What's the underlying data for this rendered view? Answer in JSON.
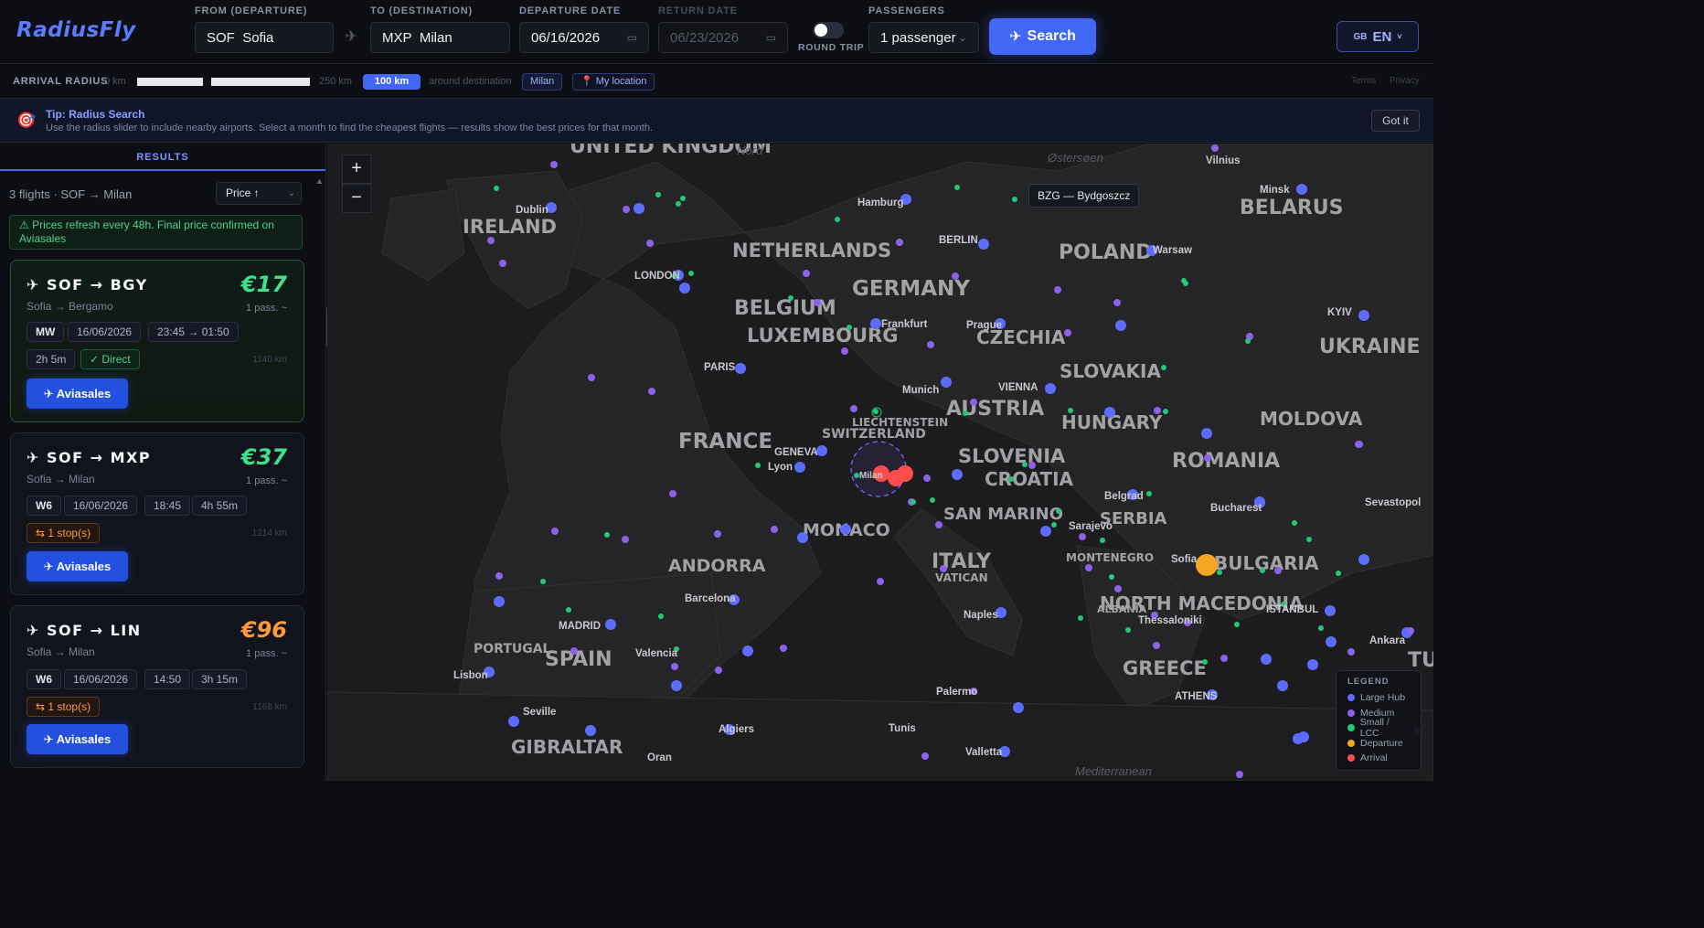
{
  "header": {
    "logo": "RadiusFly",
    "from": {
      "label": "FROM (DEPARTURE)",
      "code": "SOF",
      "city": "Sofia"
    },
    "to": {
      "label": "TO (DESTINATION)",
      "code": "MXP",
      "city": "Milan"
    },
    "departure": {
      "label": "DEPARTURE DATE",
      "value": "06/16/2026"
    },
    "return": {
      "label": "RETURN DATE",
      "value": "06/23/2026"
    },
    "round_trip_label": "ROUND TRIP",
    "round_trip_enabled": false,
    "passengers": {
      "label": "PASSENGERS",
      "value": "1 passenger"
    },
    "search_label": "Search",
    "lang": {
      "flag": "GB",
      "code": "EN"
    }
  },
  "radius": {
    "label": "ARRIVAL RADIUS",
    "min": "0 km",
    "max": "250 km",
    "value": "100 km",
    "around": "around destination",
    "destination_chip": "Milan",
    "location_chip": "My location",
    "terms": "Terms",
    "privacy": "Privacy"
  },
  "tip": {
    "title": "Tip: Radius Search",
    "body": "Use the radius slider to include nearby airports. Select a month to find the cheapest flights — results show the best prices for that month.",
    "dismiss": "Got it"
  },
  "results": {
    "tab": "RESULTS",
    "count": "3 flights · SOF → Milan",
    "sort": "Price ↑",
    "notice": "⚠ Prices refresh every 48h. Final price confirmed on Aviasales",
    "flights": [
      {
        "route": "SOF → BGY",
        "price": "€17",
        "price_color": "#3ee08a",
        "sub": "Sofia → Bergamo",
        "pass": "1 pass. ~",
        "airline": "MW",
        "date": "16/06/2026",
        "time": "23:45 → 01:50",
        "duration": "2h 5m",
        "stops": "✓ Direct",
        "distance": "1140 km",
        "button": "Aviasales"
      },
      {
        "route": "SOF → MXP",
        "price": "€37",
        "price_color": "#3ee08a",
        "sub": "Sofia → Milan",
        "pass": "1 pass. ~",
        "airline": "W6",
        "date": "16/06/2026",
        "time": "18:45",
        "duration": "4h 55m",
        "stops": "⇆ 1 stop(s)",
        "distance": "1214 km",
        "button": "Aviasales"
      },
      {
        "route": "SOF → LIN",
        "price": "€96",
        "price_color": "#ff9a3c",
        "sub": "Sofia → Milan",
        "pass": "1 pass. ~",
        "airline": "W6",
        "date": "16/06/2026",
        "time": "14:50",
        "duration": "3h 15m",
        "stops": "⇆ 1 stop(s)",
        "distance": "1168 km",
        "button": "Aviasales"
      }
    ]
  },
  "map": {
    "zoom_in": "+",
    "zoom_out": "−",
    "tooltip": "BZG — Bydgoszcz",
    "legend": {
      "title": "LEGEND",
      "items": [
        {
          "label": "Large Hub",
          "color": "#5b6cff"
        },
        {
          "label": "Medium",
          "color": "#8a63e8"
        },
        {
          "label": "Small / LCC",
          "color": "#23c77a"
        },
        {
          "label": "Departure",
          "color": "#f5a623"
        },
        {
          "label": "Arrival",
          "color": "#ff4d4d"
        }
      ]
    },
    "countries": [
      "UNITED KINGDOM",
      "IRELAND",
      "NETHERLANDS",
      "BELGIUM",
      "LUXEMBOURG",
      "GERMANY",
      "POLAND",
      "BELARUS",
      "CZECHIA",
      "SLOVAKIA",
      "UKRAINE",
      "AUSTRIA",
      "HUNGARY",
      "MOLDOVA",
      "FRANCE",
      "SWITZERLAND",
      "LIECHTENSTEIN",
      "SLOVENIA",
      "CROATIA",
      "ROMANIA",
      "SAN MARINO",
      "MONACO",
      "SERBIA",
      "ANDORRA",
      "ITALY",
      "VATICAN",
      "BULGARIA",
      "NORTH MACEDONIA",
      "ALBANIA",
      "MONTENEGRO",
      "PORTUGAL",
      "SPAIN",
      "GREECE",
      "GIBRALTAR",
      "TURKEY"
    ],
    "cities": [
      "Dublin",
      "LONDON",
      "Hamburg",
      "BERLIN",
      "Warsaw",
      "Vilnius",
      "Minsk",
      "KYIV",
      "PARIS",
      "Frankfurt",
      "Prague",
      "Munich",
      "VIENNA",
      "GENEVA",
      "Lyon",
      "Milan",
      "Belgrad",
      "Bucharest",
      "Sevastopol",
      "Sarajevo",
      "Sofia",
      "ISTANBUL",
      "Ankara",
      "Barcelona",
      "MADRID",
      "Valencia",
      "Lisbon",
      "Naples",
      "Thessaloniki",
      "Seville",
      "Algiers",
      "Palermo",
      "ATHENS",
      "Tunis",
      "Oran",
      "Valletta"
    ],
    "seas": [
      "Nord",
      "Østersøen",
      "Mediterranean"
    ]
  }
}
